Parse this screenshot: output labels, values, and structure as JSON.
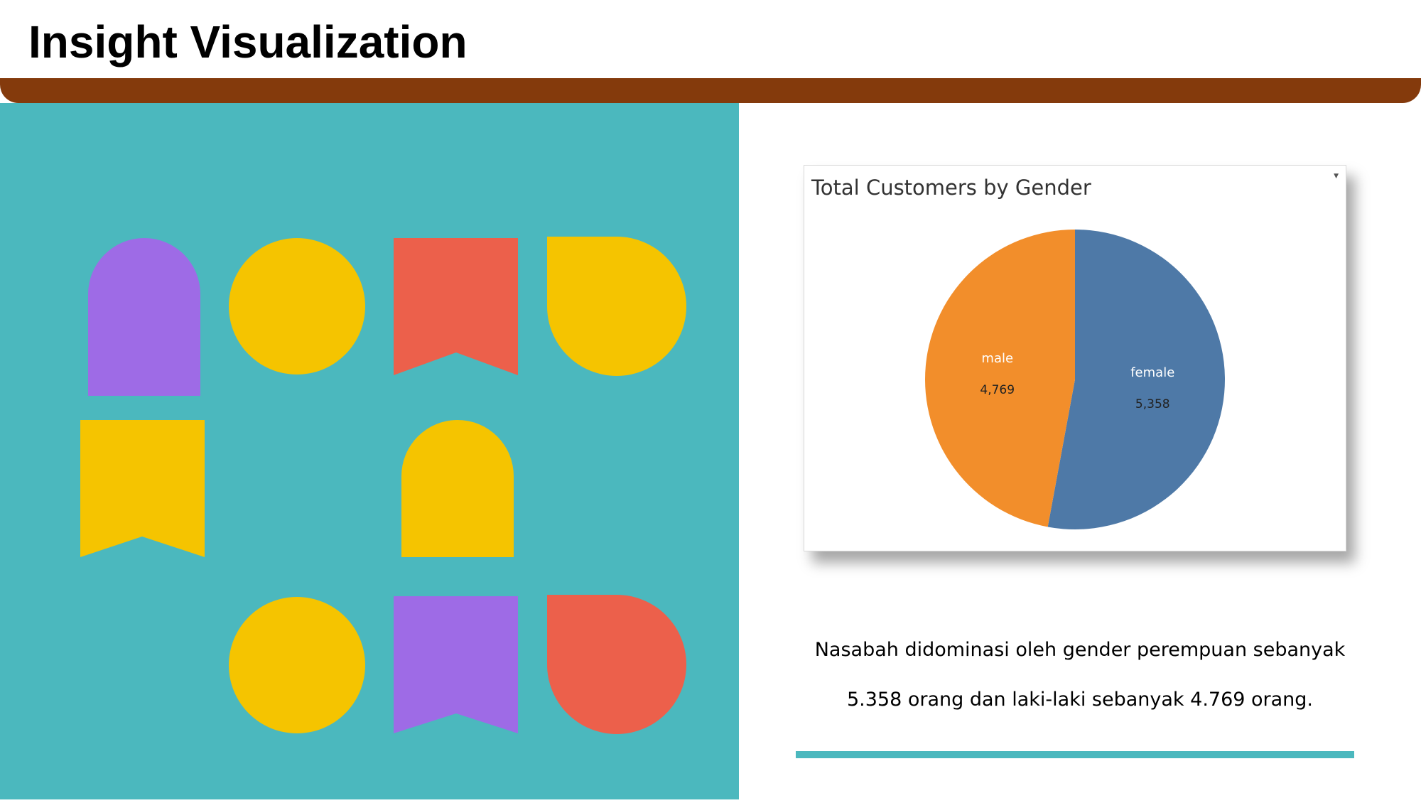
{
  "slide": {
    "title": "Insight Visualization",
    "caption_line1": "Nasabah didominasi oleh gender perempuan sebanyak",
    "caption_line2": "5.358 orang dan laki-laki sebanyak 4.769 orang."
  },
  "colors": {
    "header_bar": "#843a0c",
    "panel": "#4bb8be",
    "purple": "#9e6be6",
    "yellow": "#f5c400",
    "coral": "#ec604b"
  },
  "chart_data": {
    "type": "pie",
    "title": "Total Customers by Gender",
    "categories": [
      "female",
      "male"
    ],
    "values": [
      5358,
      4769
    ],
    "value_labels": [
      "5,358",
      "4,769"
    ],
    "colors": [
      "#4e79a7",
      "#f28e2b"
    ],
    "legend": "none",
    "start_angle": "12 o'clock, clockwise"
  }
}
